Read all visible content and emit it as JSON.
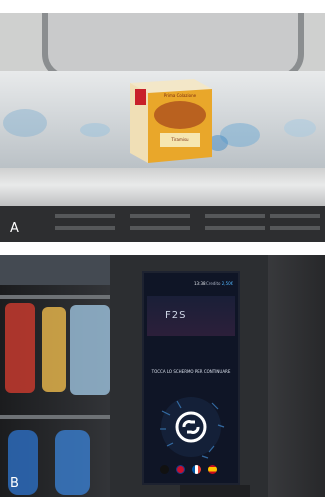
{
  "panel_a": {
    "label": "A"
  },
  "panel_b": {
    "label": "B",
    "screen": {
      "time": "13:38",
      "credit_label": "Credito",
      "credit_value": "2,50€",
      "logo_text": "F2S",
      "tap_prompt": "TOCCA LO SCHERMO PER CONTINUARE",
      "language_flags": [
        "black",
        "uk",
        "france",
        "spain"
      ]
    }
  },
  "product_box": {
    "brand": "Duo",
    "line1": "Prima Colazione",
    "line2": "Tiramisu",
    "line3": "Tiramisù"
  }
}
